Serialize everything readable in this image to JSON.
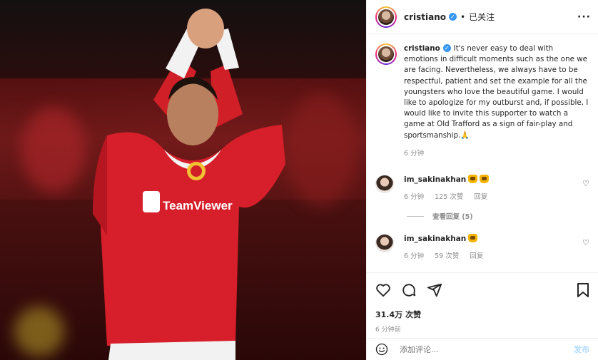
{
  "post": {
    "username": "cristiano",
    "follow_status": "已关注",
    "caption": "It's never easy to deal with emotions in difficult moments such as the one we are facing. Nevertheless, we always have to be respectful, patient and set the example for all the youngsters who love the beautiful game. I would like to apologize for my outburst and, if possible, I would like to invite this supporter to watch a game at Old Trafford as a sign of fair-play and sportsmanship.🙏",
    "caption_time": "6 分钟"
  },
  "comments": [
    {
      "username": "im_sakinakhan",
      "time": "6 分钟",
      "likes": "125 次赞",
      "reply": "回复",
      "view_replies": "查看回复 (5)"
    },
    {
      "username": "im_sakinakhan",
      "time": "6 分钟",
      "likes": "59 次赞",
      "reply": "回复"
    }
  ],
  "stats": {
    "likes": "31.4万 次赞",
    "posted": "6 分钟前"
  },
  "composer": {
    "placeholder": "添加评论...",
    "post_label": "发布"
  },
  "icons": {
    "more": "more-icon",
    "like": "heart-icon",
    "comment": "comment-icon",
    "share": "share-icon",
    "save": "bookmark-icon",
    "emoji": "smiley-icon"
  }
}
